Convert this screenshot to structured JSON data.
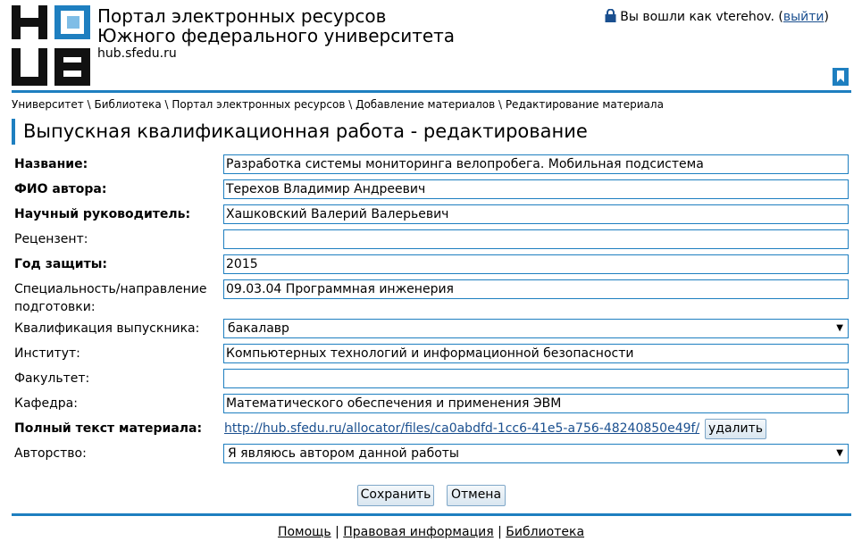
{
  "header": {
    "title_line1": "Портал электронных ресурсов",
    "title_line2": "Южного федерального университета",
    "url": "hub.sfedu.ru",
    "login_prefix": "Вы вошли как vterehov. (",
    "logout_label": "выйти",
    "login_suffix": ")"
  },
  "breadcrumb": "Университет \\ Библиотека \\ Портал электронных ресурсов \\ Добавление материалов \\ Редактирование материала",
  "page_title": "Выпускная квалификационная работа - редактирование",
  "form": {
    "title_label": "Название:",
    "title_value": "Разработка  системы  мониторинга велопробега. Мобильная подсистема",
    "author_label": "ФИО автора:",
    "author_value": "Терехов Владимир Андреевич",
    "supervisor_label": "Научный руководитель:",
    "supervisor_value": "Хашковский Валерий Валерьевич",
    "reviewer_label": "Рецензент:",
    "reviewer_value": "",
    "year_label": "Год защиты:",
    "year_value": "2015",
    "specialty_label_1": "Специальность/направление",
    "specialty_label_2": "подготовки:",
    "specialty_value": "09.03.04 Программная инженерия",
    "qualification_label": "Квалификация выпускника:",
    "qualification_value": "бакалавр",
    "institute_label": "Институт:",
    "institute_value": "Компьютерных технологий и информационной безопасности",
    "faculty_label": "Факультет:",
    "faculty_value": "",
    "department_label": "Кафедра:",
    "department_value": "Математического обеспечения и применения ЭВМ",
    "fulltext_label": "Полный текст материала:",
    "fulltext_link": "http://hub.sfedu.ru/allocator/files/ca0abdfd-1cc6-41e5-a756-48240850e49f/",
    "delete_label": "удалить",
    "authorship_label": "Авторство:",
    "authorship_value": "Я являюсь автором данной работы"
  },
  "buttons": {
    "save": "Сохранить",
    "cancel": "Отмена"
  },
  "footer": {
    "help": "Помощь",
    "legal": "Правовая информация",
    "library": "Библиотека",
    "sep": "|"
  },
  "colors": {
    "accent": "#1e7fc0",
    "link": "#1a4f8f"
  }
}
